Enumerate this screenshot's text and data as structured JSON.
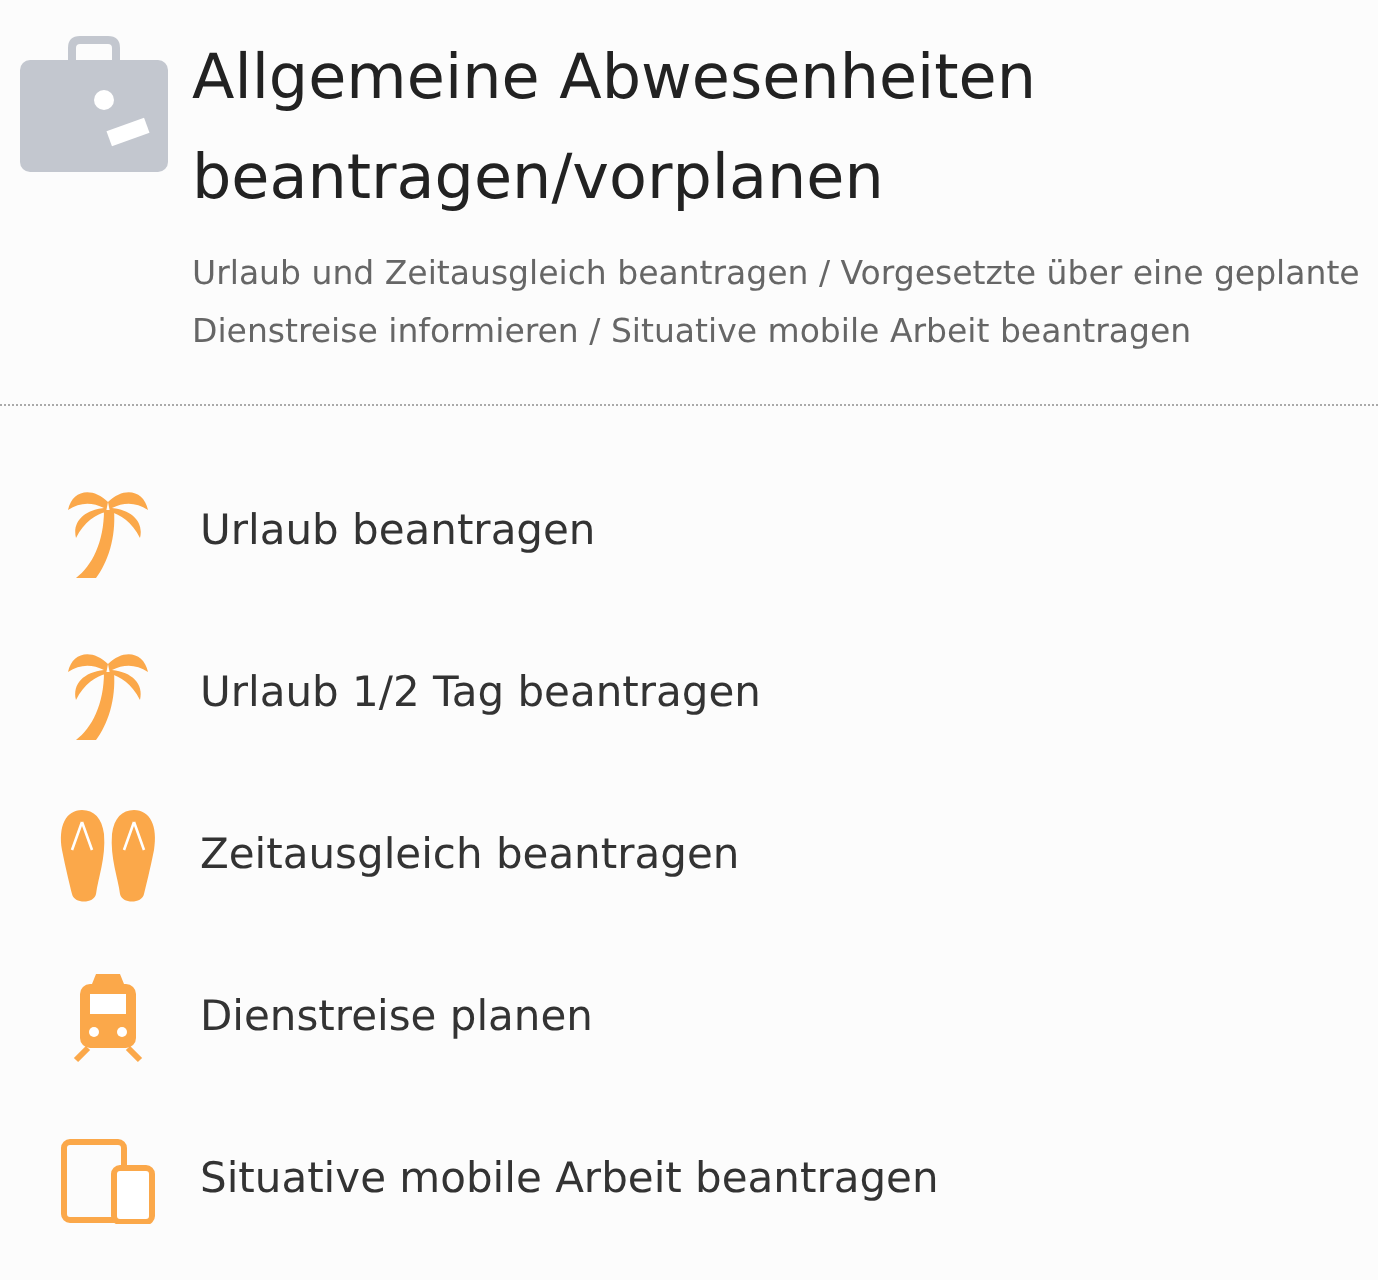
{
  "header": {
    "title": "Allgemeine Abwesenheiten beantragen/vorplanen",
    "subtitle": "Urlaub und Zeitausgleich beantragen / Vorgesetzte über eine geplante Dienstreise informieren / Situative mobile Arbeit beantragen"
  },
  "actions": [
    {
      "kind": "palm",
      "label": "Urlaub beantragen"
    },
    {
      "kind": "palm",
      "label": "Urlaub 1/2 Tag beantragen"
    },
    {
      "kind": "flipflops",
      "label": "Zeitausgleich beantragen"
    },
    {
      "kind": "train",
      "label": "Dienstreise planen"
    },
    {
      "kind": "devices",
      "label": "Situative mobile Arbeit beantragen"
    }
  ]
}
